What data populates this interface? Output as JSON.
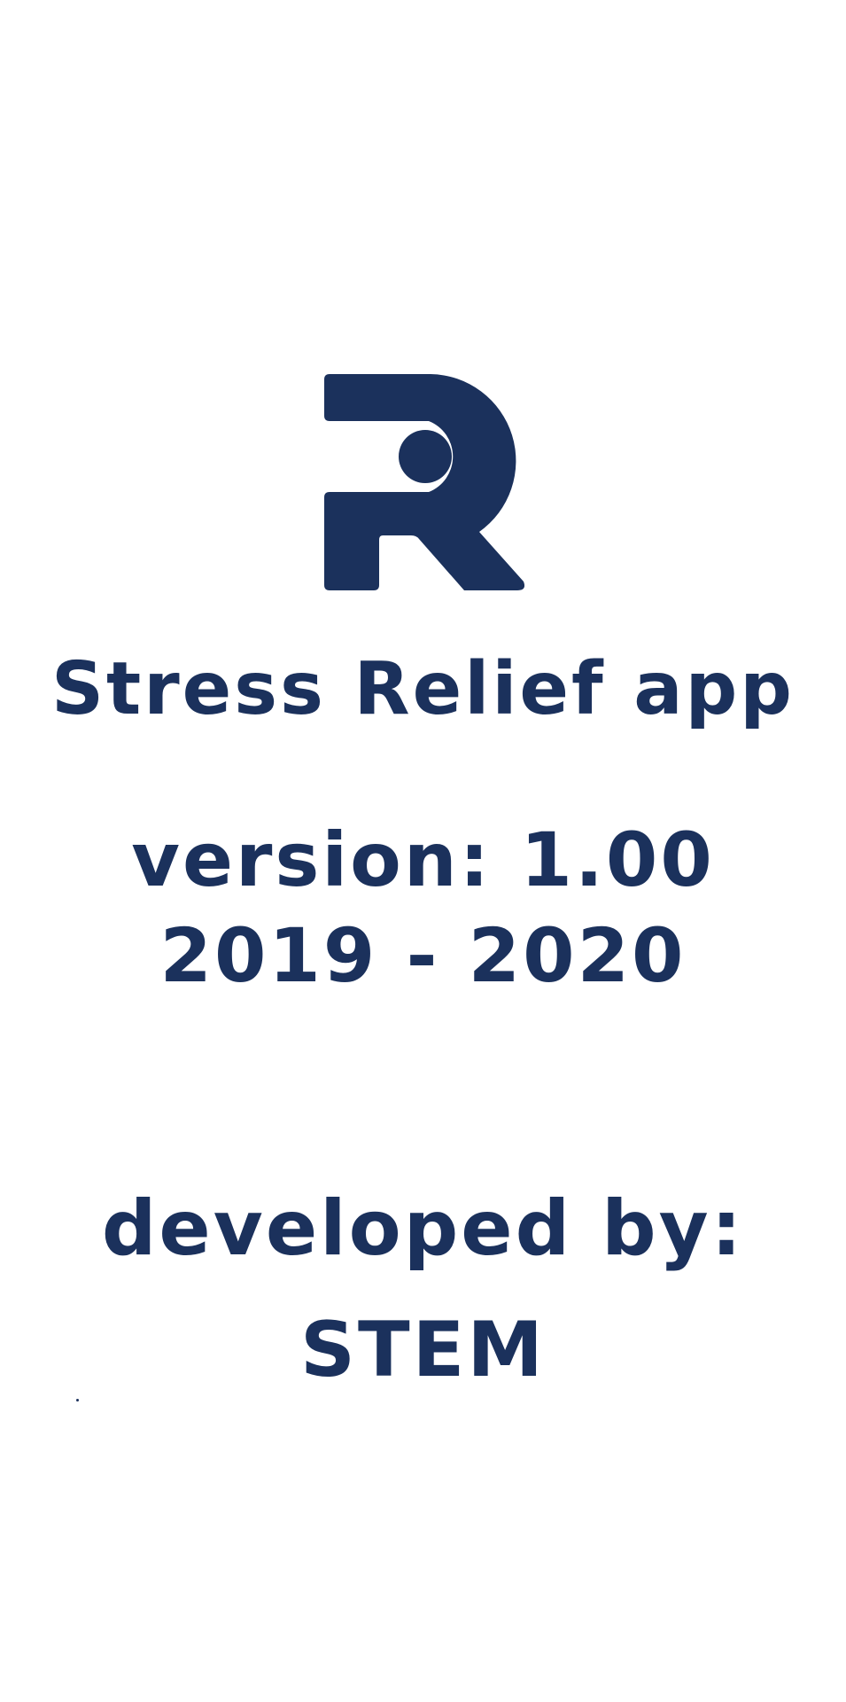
{
  "theme": {
    "background": "#ffffff",
    "accent": "#1b315c"
  },
  "logo": {
    "icon": "r-logo-icon"
  },
  "about": {
    "app_title": "Stress Relief app",
    "version": "version: 1.00",
    "years": "2019 - 2020",
    "developed_by_label": "developed by:",
    "developer": "STEM"
  }
}
